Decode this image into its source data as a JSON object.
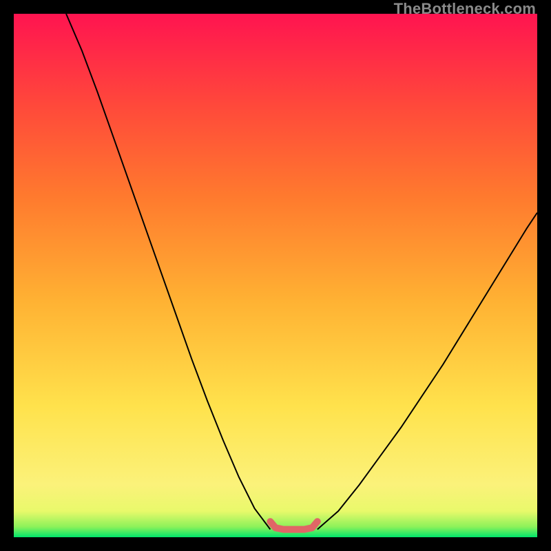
{
  "watermark": "TheBottleneck.com",
  "chart_data": {
    "type": "line",
    "title": "",
    "xlabel": "",
    "ylabel": "",
    "xlim": [
      0,
      100
    ],
    "ylim": [
      0,
      100
    ],
    "grid": false,
    "legend": false,
    "gradient_stops": [
      {
        "offset": 0.0,
        "color": "#00e56b"
      },
      {
        "offset": 0.02,
        "color": "#8df25a"
      },
      {
        "offset": 0.05,
        "color": "#e9f96b"
      },
      {
        "offset": 0.1,
        "color": "#fbf27a"
      },
      {
        "offset": 0.25,
        "color": "#ffe24c"
      },
      {
        "offset": 0.45,
        "color": "#ffb233"
      },
      {
        "offset": 0.65,
        "color": "#ff7a2e"
      },
      {
        "offset": 0.82,
        "color": "#ff4a3a"
      },
      {
        "offset": 1.0,
        "color": "#ff1450"
      }
    ],
    "series": [
      {
        "name": "left-branch",
        "stroke": "#000000",
        "stroke_width": 2,
        "x": [
          10.0,
          13.0,
          16.0,
          19.0,
          22.0,
          25.0,
          28.0,
          31.0,
          34.0,
          37.0,
          40.0,
          43.0,
          46.0,
          49.0
        ],
        "y": [
          100.0,
          93.0,
          85.0,
          76.5,
          68.0,
          59.5,
          51.0,
          42.5,
          34.0,
          26.0,
          18.5,
          11.5,
          5.5,
          1.5
        ]
      },
      {
        "name": "right-branch",
        "stroke": "#000000",
        "stroke_width": 2,
        "x": [
          58.0,
          62.0,
          66.0,
          70.0,
          74.0,
          78.0,
          82.0,
          86.0,
          90.0,
          94.0,
          98.0,
          100.0
        ],
        "y": [
          1.5,
          5.0,
          10.0,
          15.5,
          21.0,
          27.0,
          33.0,
          39.5,
          46.0,
          52.5,
          59.0,
          62.0
        ]
      },
      {
        "name": "valley-bar",
        "stroke": "#e06666",
        "stroke_width": 10,
        "linecap": "round",
        "x": [
          49.0,
          50.0,
          51.5,
          53.5,
          55.5,
          57.0,
          58.0
        ],
        "y": [
          3.0,
          1.8,
          1.5,
          1.5,
          1.5,
          1.8,
          3.0
        ]
      }
    ]
  }
}
